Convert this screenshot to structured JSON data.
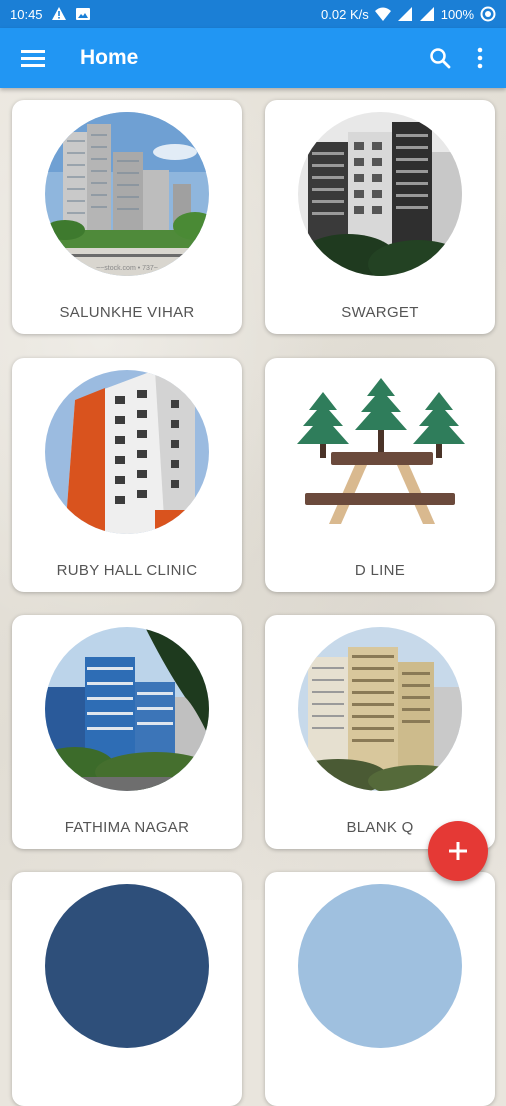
{
  "status_bar": {
    "time": "10:45",
    "network_speed": "0.02 K/s",
    "battery": "100%",
    "icons": [
      "warning-icon",
      "image-icon",
      "wifi-icon",
      "signal-icon",
      "battery-icon"
    ]
  },
  "app_bar": {
    "title": "Home",
    "color": "#2196f3",
    "icons": [
      "menu-icon",
      "search-icon",
      "more-vert-icon"
    ]
  },
  "cards": [
    {
      "label": "SALUNKHE VIHAR",
      "thumb_caption": "~~stock.com • 737~"
    },
    {
      "label": "SWARGET"
    },
    {
      "label": "RUBY HALL CLINIC"
    },
    {
      "label": "D LINE"
    },
    {
      "label": "FATHIMA NAGAR"
    },
    {
      "label": "BLANK Q"
    }
  ],
  "fab": {
    "icon": "add-icon",
    "color": "#e53935"
  }
}
